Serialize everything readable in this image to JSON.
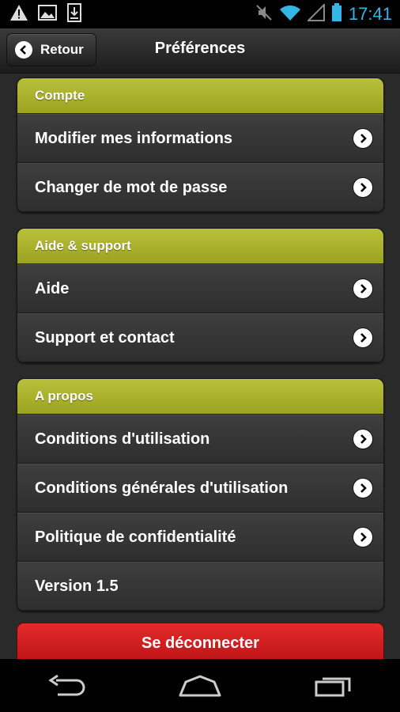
{
  "status_bar": {
    "time": "17:41",
    "icons": [
      "warning-icon",
      "image-icon",
      "download-icon",
      "mute-icon",
      "wifi-icon",
      "signal-icon",
      "battery-icon"
    ]
  },
  "header": {
    "back_label": "Retour",
    "title": "Préférences"
  },
  "sections": [
    {
      "title": "Compte",
      "items": [
        "Modifier mes informations",
        "Changer de mot de passe"
      ]
    },
    {
      "title": "Aide & support",
      "items": [
        "Aide",
        "Support et contact"
      ]
    },
    {
      "title": "A propos",
      "items": [
        "Conditions d'utilisation",
        "Conditions générales d'utilisation",
        "Politique de confidentialité"
      ],
      "version": "Version 1.5"
    }
  ],
  "logout_label": "Se déconnecter",
  "colors": {
    "section_header": "#a9b02a",
    "logout": "#d01c1f",
    "clock": "#33b5e5"
  }
}
